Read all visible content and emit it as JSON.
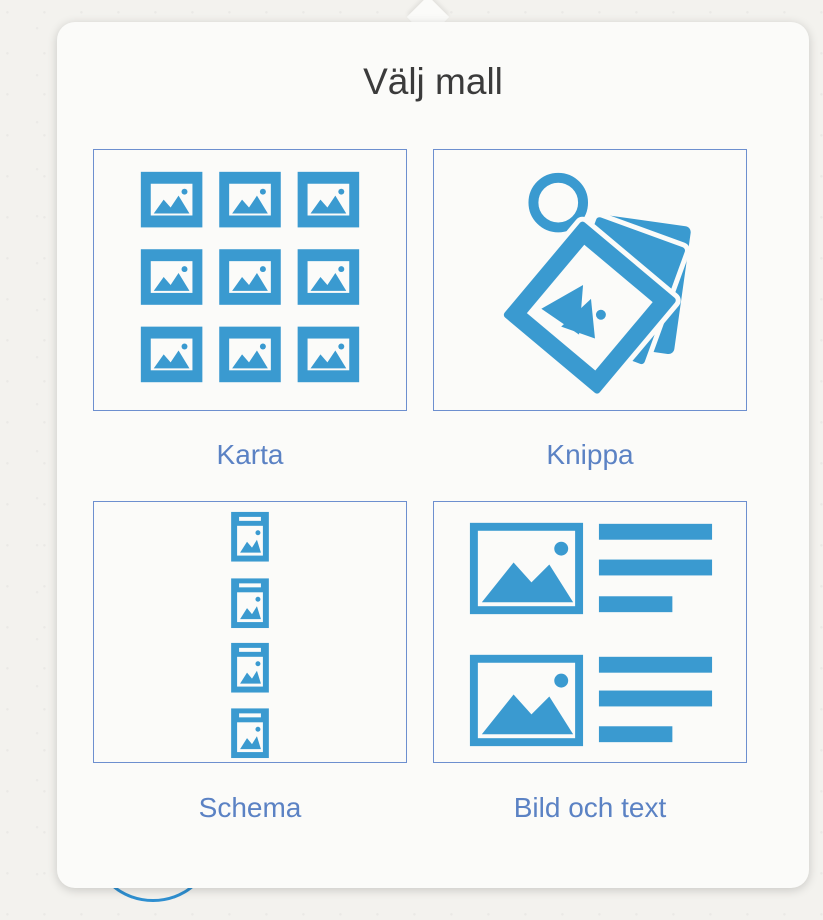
{
  "dialog": {
    "title": "Välj mall"
  },
  "templates": [
    {
      "label": "Karta",
      "icon": "image-grid-icon"
    },
    {
      "label": "Knippa",
      "icon": "keyring-cards-icon"
    },
    {
      "label": "Schema",
      "icon": "vertical-image-list-icon"
    },
    {
      "label": "Bild och text",
      "icon": "image-with-text-icon"
    }
  ],
  "colors": {
    "icon": "#3a9ad0",
    "tile_border": "#6d8fcf",
    "label": "#5b82c4"
  }
}
